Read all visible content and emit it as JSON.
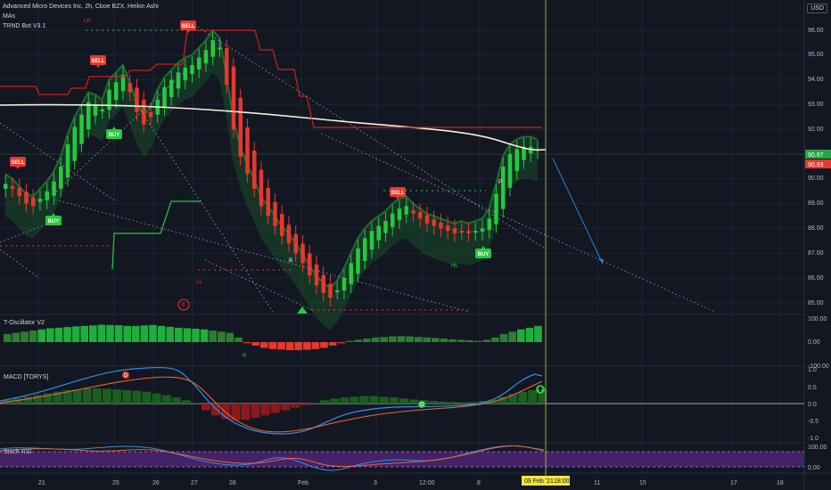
{
  "header": {
    "title": "Advanced Micro Devices Inc, 2h, Cboe BZX, Heikin Ashi",
    "indicator1": "MAs",
    "indicator2": "TRND Bot V3.1",
    "currency": "USD"
  },
  "price_axis": {
    "ticks": [
      "96.00",
      "95.00",
      "94.00",
      "93.00",
      "92.00",
      "91.00",
      "90.00",
      "89.00",
      "88.00",
      "87.00",
      "86.00",
      "85.00"
    ],
    "last_price": "90.97",
    "second_price": "90.93"
  },
  "signals": {
    "sell_labels": [
      "SELL",
      "SELL",
      "SELL",
      "SELL"
    ],
    "buy_labels": [
      "BUY",
      "BUY",
      "BUY"
    ],
    "lh": "LH",
    "ll": "LL",
    "hl": "HL",
    "e_marker": "E",
    "b_marker": "B",
    "p_marker": "P"
  },
  "panes": {
    "osc": {
      "label": "T-Oscillator V2",
      "ticks": [
        "100.00",
        "0.00",
        "-100.00"
      ],
      "marker": "R"
    },
    "macd": {
      "label": "MACD [TORYS]",
      "ticks": [
        "1.0",
        "0.5",
        "0.0",
        "-0.5",
        "-1.0"
      ],
      "marker_d1": "D",
      "marker_d2": "D"
    },
    "stoch": {
      "label": "Stoch RSI",
      "ticks": [
        "100.00",
        "0.00"
      ]
    }
  },
  "time_axis": {
    "labels": [
      "21",
      "25",
      "26",
      "27",
      "28",
      "Feb",
      "3",
      "12:00",
      "8",
      "11",
      "15",
      "17",
      "18"
    ],
    "crosshair": "09 Feb '21",
    "crosshair_time": "18:00"
  },
  "colors": {
    "background": "#131722",
    "bull": "#26c940",
    "bear": "#e8372c",
    "accent_yellow": "#f5e63c",
    "ema_white": "#f5f1dc",
    "stoch_band": "#5b2a8c"
  }
}
